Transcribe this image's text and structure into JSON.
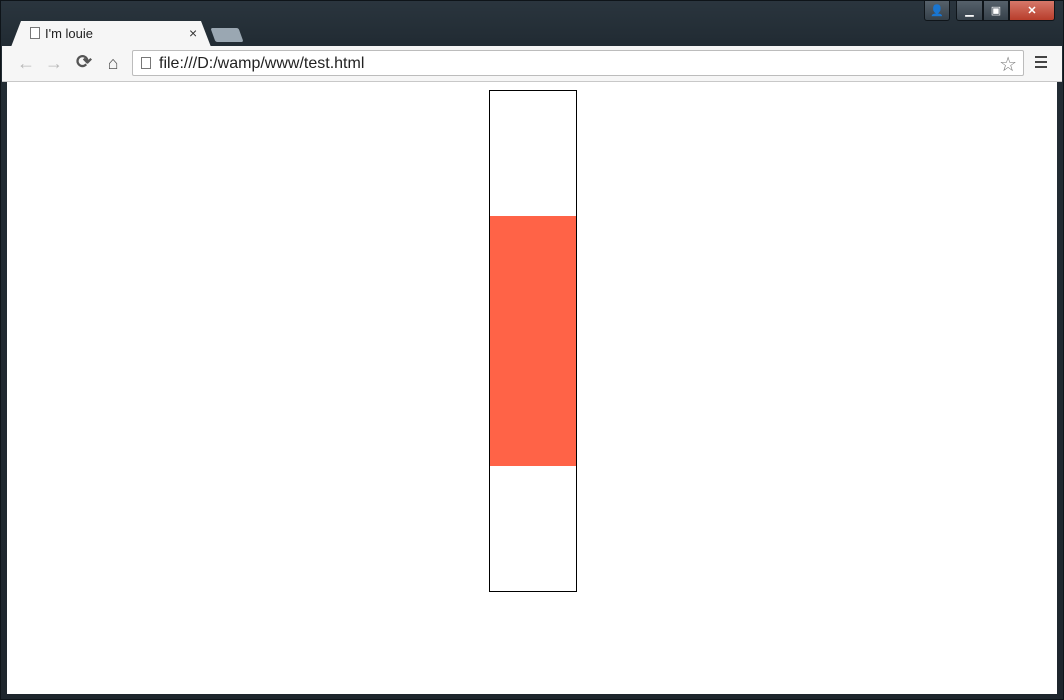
{
  "tab": {
    "title": "I'm louie",
    "close_glyph": "×"
  },
  "window_controls": {
    "user_glyph": "👤",
    "min_glyph": "▁",
    "max_glyph": "▣",
    "close_glyph": "✕"
  },
  "toolbar": {
    "back_glyph": "←",
    "forward_glyph": "→",
    "reload_glyph": "⟳",
    "home_glyph": "⌂",
    "url": "file:///D:/wamp/www/test.html",
    "star_glyph": "☆"
  },
  "content": {
    "bar_color": "#ff6347"
  }
}
